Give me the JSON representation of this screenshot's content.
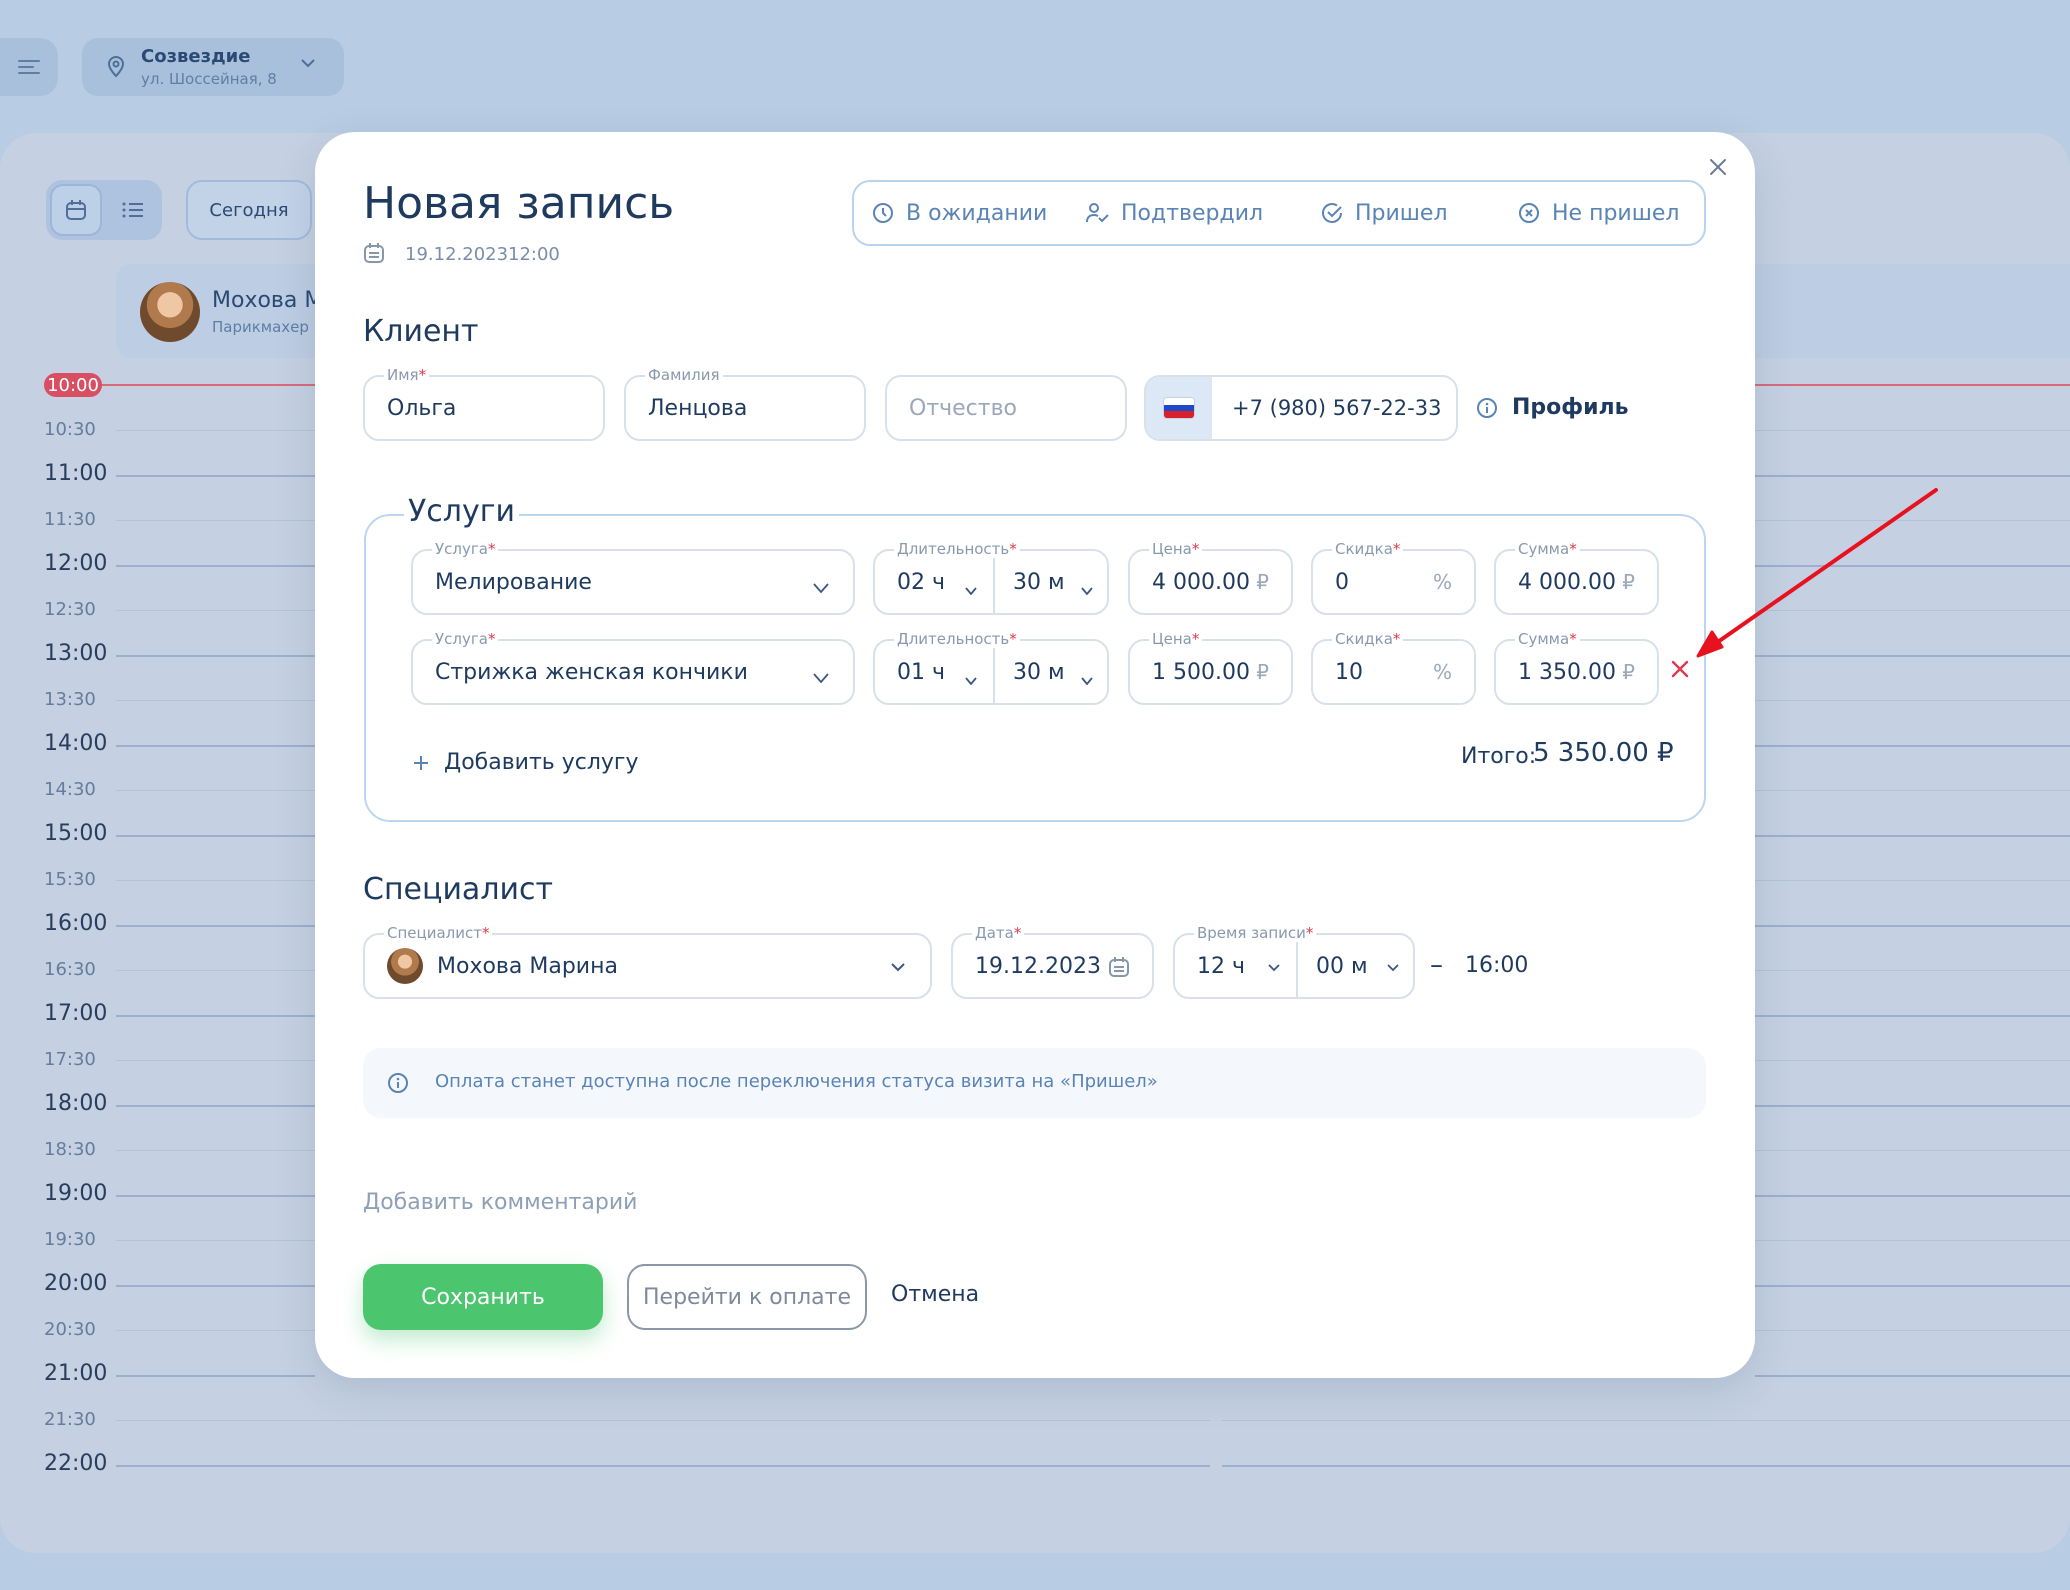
{
  "background": {
    "location": {
      "name": "Созвездие",
      "address": "ул. Шоссейная, 8"
    },
    "today_button": "Сегодня",
    "staff": {
      "name": "Мохова М",
      "role": "Парикмахер"
    },
    "now_label": "10:00",
    "times": [
      "10:30",
      "11:00",
      "11:30",
      "12:00",
      "12:30",
      "13:00",
      "13:30",
      "14:00",
      "14:30",
      "15:00",
      "15:30",
      "16:00",
      "16:30",
      "17:00",
      "17:30",
      "18:00",
      "18:30",
      "19:00",
      "19:30",
      "20:00",
      "20:30",
      "21:00",
      "21:30",
      "22:00"
    ]
  },
  "modal": {
    "title": "Новая запись",
    "date": "19.12.2023",
    "time": "12:00",
    "statuses": [
      {
        "label": "В ожидании",
        "icon": "clock-icon"
      },
      {
        "label": "Подтвердил",
        "icon": "user-check-icon"
      },
      {
        "label": "Пришел",
        "icon": "check-circle-icon"
      },
      {
        "label": "Не пришел",
        "icon": "x-circle-icon"
      }
    ],
    "client": {
      "heading": "Клиент",
      "first_name_label": "Имя",
      "first_name": "Ольга",
      "last_name_label": "Фамилия",
      "last_name": "Ленцова",
      "patronymic_placeholder": "Отчество",
      "phone": "+7 (980) 567-22-33",
      "profile_link": "Профиль"
    },
    "services": {
      "heading": "Услуги",
      "labels": {
        "service": "Услуга",
        "duration": "Длительность",
        "price": "Цена",
        "discount": "Скидка",
        "sum": "Сумма"
      },
      "currency": "₽",
      "percent": "%",
      "rows": [
        {
          "service": "Мелирование",
          "hours": "02 ч",
          "minutes": "30 м",
          "price": "4 000.00",
          "discount": "0",
          "sum": "4 000.00"
        },
        {
          "service": "Стрижка женская кончики",
          "hours": "01 ч",
          "minutes": "30 м",
          "price": "1 500.00",
          "discount": "10",
          "sum": "1 350.00"
        }
      ],
      "add_service": "Добавить услугу",
      "total_label": "Итого:",
      "total_value": "5 350.00 ₽"
    },
    "specialist": {
      "heading": "Специалист",
      "specialist_label": "Специалист",
      "specialist_name": "Мохова Марина",
      "date_label": "Дата",
      "date": "19.12.2023",
      "time_label": "Время записи",
      "hours": "12 ч",
      "minutes": "00 м",
      "dash": "–",
      "end_time": "16:00"
    },
    "info_text": "Оплата станет доступна после переключения статуса визита на «Пришел»",
    "comment_link": "Добавить комментарий",
    "buttons": {
      "save": "Сохранить",
      "pay": "Перейти к оплате",
      "cancel": "Отмена"
    }
  },
  "colors": {
    "accent_green": "#4cc56f",
    "status_blue": "#5a84b5",
    "required_red": "#e0384f",
    "annotation_red": "#e8121f"
  }
}
